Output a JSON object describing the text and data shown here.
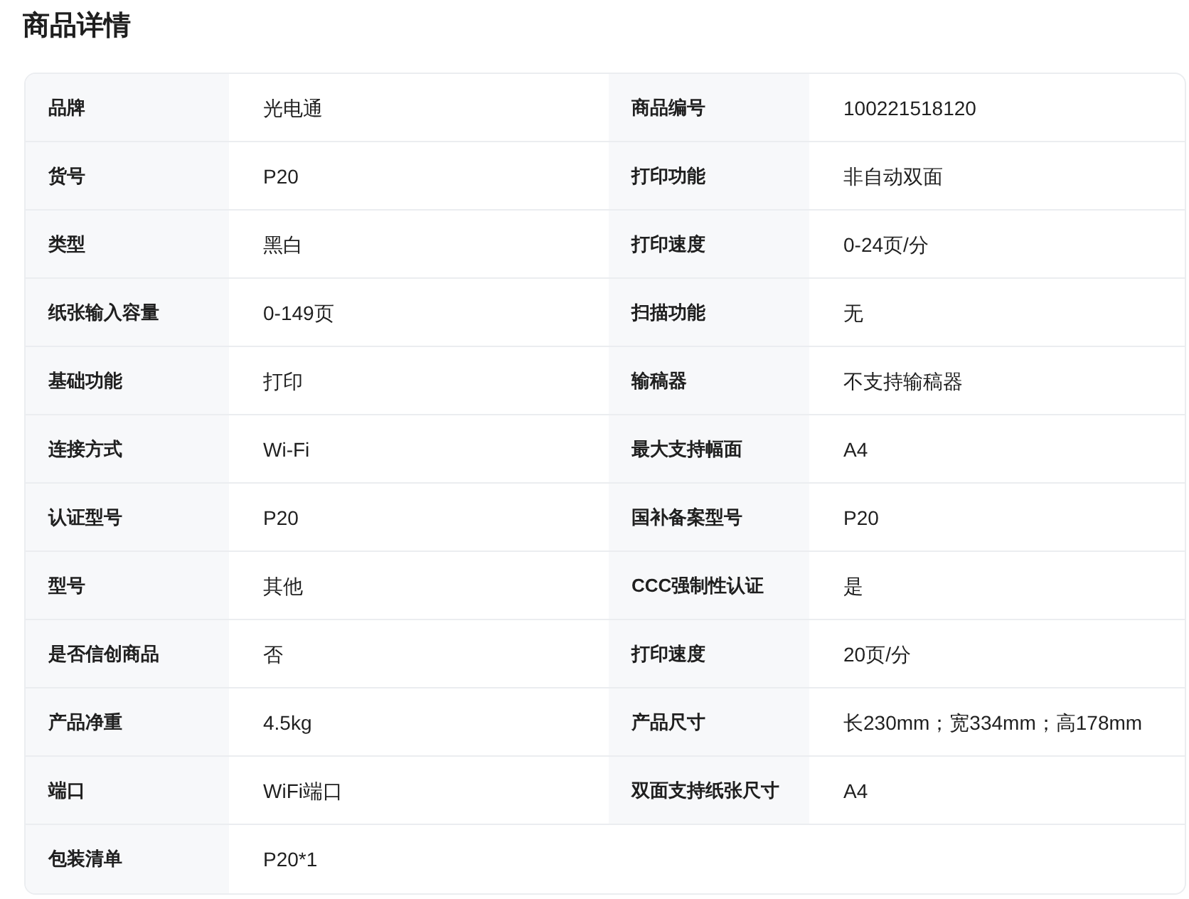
{
  "title": "商品详情",
  "rows": [
    [
      {
        "label": "品牌",
        "value": "光电通"
      },
      {
        "label": "商品编号",
        "value": "100221518120"
      }
    ],
    [
      {
        "label": "货号",
        "value": "P20"
      },
      {
        "label": "打印功能",
        "value": "非自动双面"
      }
    ],
    [
      {
        "label": "类型",
        "value": "黑白"
      },
      {
        "label": "打印速度",
        "value": "0-24页/分"
      }
    ],
    [
      {
        "label": "纸张输入容量",
        "value": "0-149页"
      },
      {
        "label": "扫描功能",
        "value": "无"
      }
    ],
    [
      {
        "label": "基础功能",
        "value": "打印"
      },
      {
        "label": "输稿器",
        "value": "不支持输稿器"
      }
    ],
    [
      {
        "label": "连接方式",
        "value": "Wi-Fi"
      },
      {
        "label": "最大支持幅面",
        "value": "A4"
      }
    ],
    [
      {
        "label": "认证型号",
        "value": "P20"
      },
      {
        "label": "国补备案型号",
        "value": "P20"
      }
    ],
    [
      {
        "label": "型号",
        "value": "其他"
      },
      {
        "label": "CCC强制性认证",
        "value": "是"
      }
    ],
    [
      {
        "label": "是否信创商品",
        "value": "否"
      },
      {
        "label": "打印速度",
        "value": "20页/分"
      }
    ],
    [
      {
        "label": "产品净重",
        "value": "4.5kg"
      },
      {
        "label": "产品尺寸",
        "value": "长230mm；宽334mm；高178mm"
      }
    ],
    [
      {
        "label": "端口",
        "value": "WiFi端口"
      },
      {
        "label": "双面支持纸张尺寸",
        "value": "A4"
      }
    ],
    [
      {
        "label": "包装清单",
        "value": "P20*1"
      }
    ]
  ]
}
